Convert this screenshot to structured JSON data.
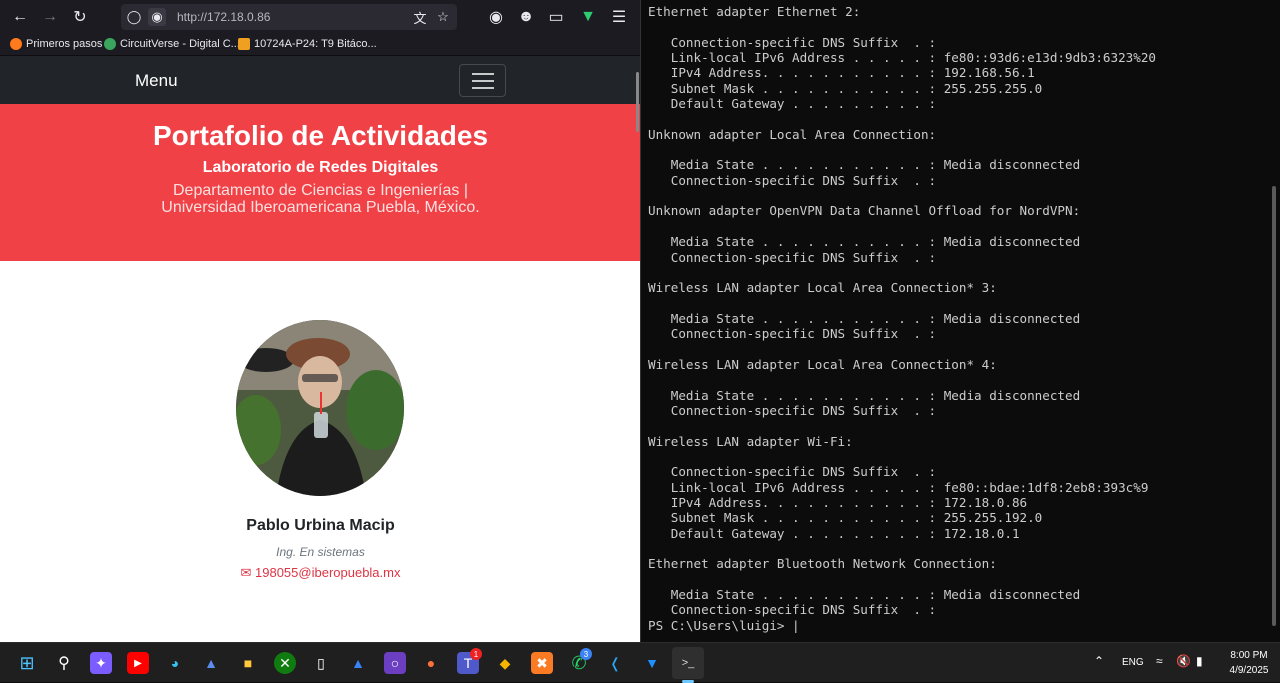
{
  "browser": {
    "url": "http://172.18.0.86",
    "bookmarks": [
      "Primeros pasos",
      "CircuitVerse - Digital C...",
      "10724A-P24: T9 Bitáco..."
    ]
  },
  "site": {
    "menu_label": "Menu",
    "title": "Portafolio de Actividades",
    "subtitle": "Laboratorio de Redes Digitales",
    "dept_line1": "Departamento de Ciencias e Ingenierías |",
    "dept_line2": "Universidad Iberoamericana Puebla, México.",
    "name": "Pablo Urbina Macip",
    "role": "Ing. En sistemas",
    "email": "198055@iberopuebla.mx"
  },
  "terminal": {
    "lines": [
      "Ethernet adapter Ethernet 2:",
      "",
      "   Connection-specific DNS Suffix  . :",
      "   Link-local IPv6 Address . . . . . : fe80::93d6:e13d:9db3:6323%20",
      "   IPv4 Address. . . . . . . . . . . : 192.168.56.1",
      "   Subnet Mask . . . . . . . . . . . : 255.255.255.0",
      "   Default Gateway . . . . . . . . . :",
      "",
      "Unknown adapter Local Area Connection:",
      "",
      "   Media State . . . . . . . . . . . : Media disconnected",
      "   Connection-specific DNS Suffix  . :",
      "",
      "Unknown adapter OpenVPN Data Channel Offload for NordVPN:",
      "",
      "   Media State . . . . . . . . . . . : Media disconnected",
      "   Connection-specific DNS Suffix  . :",
      "",
      "Wireless LAN adapter Local Area Connection* 3:",
      "",
      "   Media State . . . . . . . . . . . : Media disconnected",
      "   Connection-specific DNS Suffix  . :",
      "",
      "Wireless LAN adapter Local Area Connection* 4:",
      "",
      "   Media State . . . . . . . . . . . : Media disconnected",
      "   Connection-specific DNS Suffix  . :",
      "",
      "Wireless LAN adapter Wi-Fi:",
      "",
      "   Connection-specific DNS Suffix  . :",
      "   Link-local IPv6 Address . . . . . : fe80::bdae:1df8:2eb8:393c%9",
      "   IPv4 Address. . . . . . . . . . . : 172.18.0.86",
      "   Subnet Mask . . . . . . . . . . . : 255.255.192.0",
      "   Default Gateway . . . . . . . . . : 172.18.0.1",
      "",
      "Ethernet adapter Bluetooth Network Connection:",
      "",
      "   Media State . . . . . . . . . . . : Media disconnected",
      "   Connection-specific DNS Suffix  . :",
      "PS C:\\Users\\luigi> |"
    ]
  },
  "taskbar": {
    "language": "ENG",
    "time": "8:00 PM",
    "date": "4/9/2025",
    "teams_badge": "1",
    "whatsapp_badge": "3"
  },
  "colors": {
    "hero": "#f04146",
    "navbar": "#212529",
    "email": "#dc3545",
    "terminal_bg": "#0c0c0c"
  }
}
